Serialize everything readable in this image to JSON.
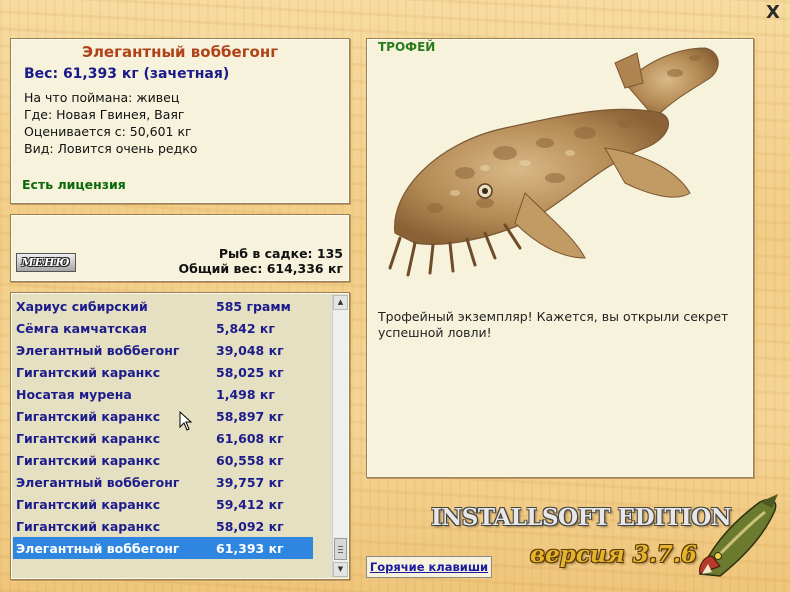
{
  "window": {
    "close_label": "X"
  },
  "info": {
    "fish_name": "Элегантный воббегонг",
    "weight_line": "Вес: 61,393 кг (зачетная)",
    "bait": "На что поймана: живец",
    "location": "Где: Новая Гвинея, Ваяг",
    "value": "Оценивается с: 50,601 кг",
    "rarity": "Вид: Ловится очень редко",
    "license": "Есть лицензия"
  },
  "cage": {
    "menu_label": "МЕНЮ",
    "count": "Рыб в садке: 135",
    "total": "Общий вес: 614,336 кг"
  },
  "catch_list": [
    {
      "name": "Хариус сибирский",
      "weight": "585 грамм"
    },
    {
      "name": "Сёмга камчатская",
      "weight": "5,842 кг"
    },
    {
      "name": "Элегантный воббегонг",
      "weight": "39,048 кг"
    },
    {
      "name": "Гигантский каранкс",
      "weight": "58,025 кг"
    },
    {
      "name": "Носатая мурена",
      "weight": "1,498 кг"
    },
    {
      "name": "Гигантский каранкс",
      "weight": "58,897 кг"
    },
    {
      "name": "Гигантский каранкс",
      "weight": "61,608 кг"
    },
    {
      "name": "Гигантский каранкс",
      "weight": "60,558 кг"
    },
    {
      "name": "Элегантный воббегонг",
      "weight": "39,757 кг"
    },
    {
      "name": "Гигантский каранкс",
      "weight": "59,412 кг"
    },
    {
      "name": "Гигантский каранкс",
      "weight": "58,092 кг"
    },
    {
      "name": "Элегантный воббегонг",
      "weight": "61,393 кг",
      "selected": true
    }
  ],
  "trophy": {
    "title": "ТРОФЕЙ",
    "message": "Трофейный экземпляр! Кажется, вы открыли секрет успешной ловли!"
  },
  "footer": {
    "hotkeys_label": "Горячие клавиши",
    "brand": "INSTALLSOFT EDITION",
    "version": "версия 3.7.6"
  },
  "colors": {
    "fish_name": "#b04218",
    "list_text": "#1c1c8c",
    "selection": "#2f86e0",
    "license": "#0a6a0a",
    "trophy_title": "#2a7d1c",
    "version": "#e6b32c"
  },
  "icons": {
    "close": "close-icon",
    "scroll_up": "arrow-up-icon",
    "scroll_down": "arrow-down-icon",
    "logo": "pike-fish-logo-icon",
    "cursor": "mouse-pointer-icon"
  }
}
